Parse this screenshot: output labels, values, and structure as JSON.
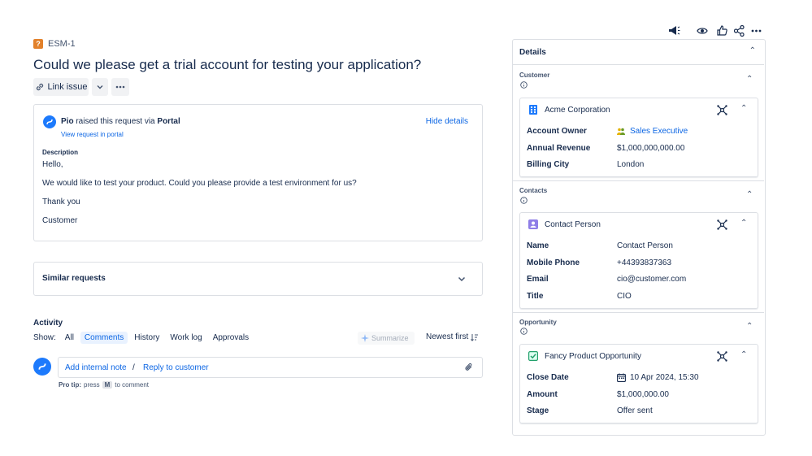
{
  "issue": {
    "key": "ESM-1",
    "title": "Could we please get a trial account for testing your application?",
    "link_issue_label": "Link issue"
  },
  "request": {
    "reporter": "Pio",
    "raised_text": "raised this request via",
    "channel": "Portal",
    "view_portal_link": "View request in portal",
    "hide_details": "Hide details",
    "description_label": "Description",
    "description_lines": [
      "Hello,",
      "We would like to test your product. Could you please provide a test environment for us?",
      "Thank you",
      "Customer"
    ]
  },
  "similar": {
    "label": "Similar requests"
  },
  "activity": {
    "heading": "Activity",
    "show_label": "Show:",
    "filters": [
      "All",
      "Comments",
      "History",
      "Work log",
      "Approvals"
    ],
    "active_filter": "Comments",
    "summarize": "Summarize",
    "sort": "Newest first",
    "add_internal_note": "Add internal note",
    "separator": "/",
    "reply_to_customer": "Reply to customer",
    "protip_label": "Pro tip:",
    "protip_press": "press",
    "protip_key": "M",
    "protip_suffix": "to comment"
  },
  "details": {
    "heading": "Details",
    "sections": [
      {
        "label": "Customer",
        "card_title": "Acme Corporation",
        "icon": "building-icon",
        "fields": [
          {
            "label": "Account Owner",
            "value": "Sales Executive",
            "is_link": true
          },
          {
            "label": "Annual Revenue",
            "value": "$1,000,000,000.00"
          },
          {
            "label": "Billing City",
            "value": "London"
          }
        ]
      },
      {
        "label": "Contacts",
        "card_title": "Contact Person",
        "icon": "contact-icon",
        "fields": [
          {
            "label": "Name",
            "value": "Contact Person"
          },
          {
            "label": "Mobile Phone",
            "value": "+44393837363"
          },
          {
            "label": "Email",
            "value": "cio@customer.com"
          },
          {
            "label": "Title",
            "value": "CIO"
          }
        ]
      },
      {
        "label": "Opportunity",
        "card_title": "Fancy Product Opportunity",
        "icon": "checkbox-icon",
        "fields": [
          {
            "label": "Close Date",
            "value": "10 Apr 2024, 15:30"
          },
          {
            "label": "Amount",
            "value": "$1,000,000.00"
          },
          {
            "label": "Stage",
            "value": "Offer sent"
          }
        ]
      }
    ]
  },
  "colors": {
    "link": "#0c66e4",
    "brand_avatar": "#1d7afc",
    "customer_icon": "#1d7afc",
    "contact_icon": "#8f7ee7",
    "opportunity_icon": "#22a06b",
    "issue_type": "#e2812b"
  }
}
